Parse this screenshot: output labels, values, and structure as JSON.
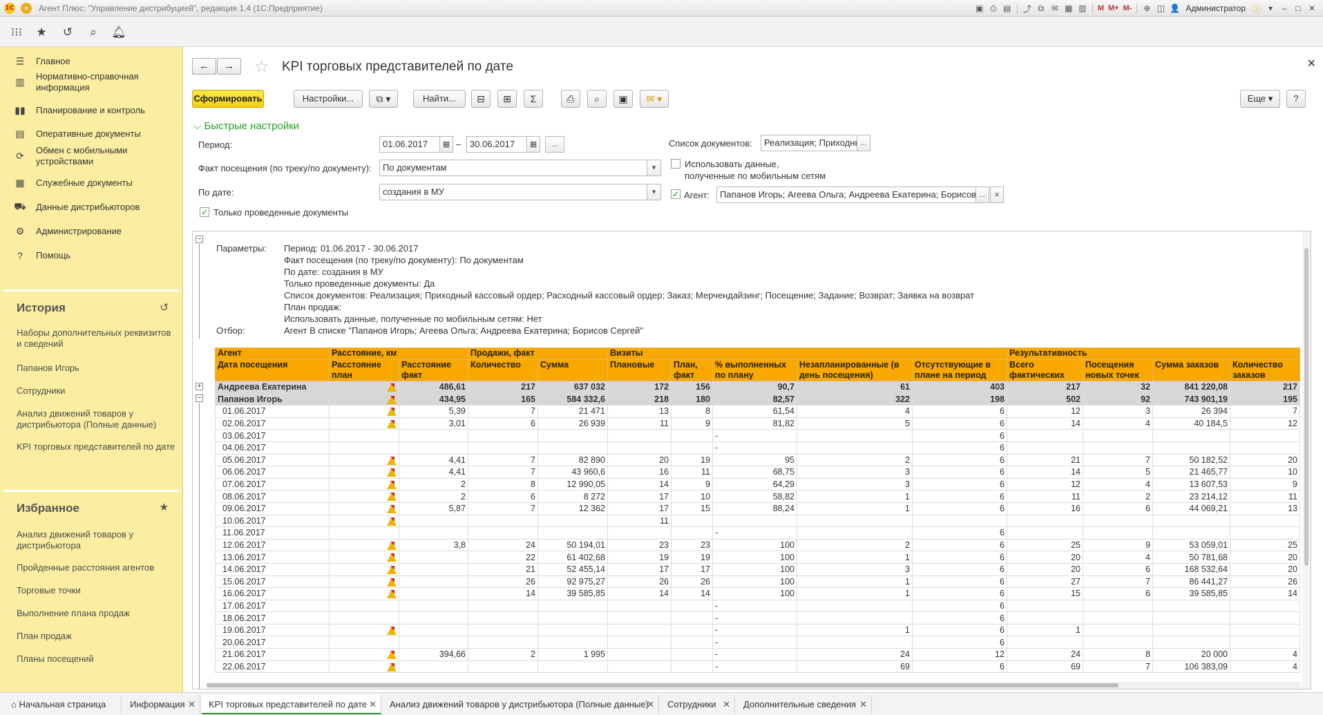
{
  "window": {
    "title": "Агент Плюс: \"Управление дистрибуцией\", редакция 1.4  (1С:Предприятие)",
    "user": "Администратор",
    "m_labels": [
      "M",
      "M+",
      "M-"
    ]
  },
  "sidebar": {
    "items": [
      {
        "icon": "menu-icon",
        "label": "Главное"
      },
      {
        "icon": "catalog-icon",
        "label": "Нормативно-справочная информация"
      },
      {
        "icon": "chart-icon",
        "label": "Планирование и контроль"
      },
      {
        "icon": "docs-icon",
        "label": "Оперативные документы"
      },
      {
        "icon": "sync-icon",
        "label": "Обмен с мобильными устройствами"
      },
      {
        "icon": "service-docs-icon",
        "label": "Служебные документы"
      },
      {
        "icon": "distributor-icon",
        "label": "Данные дистрибьюторов"
      },
      {
        "icon": "gear-icon",
        "label": "Администрирование"
      },
      {
        "icon": "help-icon",
        "label": "Помощь"
      }
    ],
    "history_title": "История",
    "history": [
      "Наборы дополнительных реквизитов и сведений",
      "Папанов Игорь",
      "Сотрудники",
      "Анализ движений товаров у дистрибьютора (Полные данные)",
      "KPI торговых представителей по дате"
    ],
    "favorites_title": "Избранное",
    "favorites": [
      "Анализ движений товаров у дистрибьютора",
      "Пройденные расстояния агентов",
      "Торговые точки",
      "Выполнение плана продаж",
      "План продаж",
      "Планы посещений"
    ]
  },
  "form": {
    "title": "KPI торговых представителей по дате",
    "generate_label": "Сформировать",
    "settings_label": "Настройки...",
    "find_label": "Найти...",
    "more_label": "Еще",
    "help_label": "?",
    "quick_settings": "Быстрые настройки",
    "period_label": "Период:",
    "period_from": "01.06.2017",
    "period_to": "30.06.2017",
    "dash": "–",
    "fact_label": "Факт посещения (по треку/по документу):",
    "fact_value": "По документам",
    "bydate_label": "По дате:",
    "bydate_value": "создания в МУ",
    "only_posted": "Только проведенные документы",
    "doclist_label": "Список документов:",
    "doclist_value": "Реализация; Приходный кассовый ордер",
    "mobile_line1": "Использовать данные,",
    "mobile_line2": "полученные по мобильным сетям",
    "agent_label": "Агент:",
    "agent_value": "Папанов Игорь; Агеева Ольга; Андреева Екатерина; Борисов Сергей",
    "ellipsis": "...",
    "clear": "×"
  },
  "report": {
    "params_label": "Параметры:",
    "params": [
      "Период: 01.06.2017 - 30.06.2017",
      "Факт посещения (по треку/по документу): По документам",
      "По дате: создания в МУ",
      "Только проведенные документы: Да",
      "Список документов: Реализация; Приходный кассовый ордер; Расходный кассовый ордер; Заказ; Мерчендайзинг; Посещение; Задание; Возврат; Заявка на возврат",
      "План продаж:",
      "Использовать данные, полученные по мобильным сетям: Нет"
    ],
    "filter_label": "Отбор:",
    "filter": "Агент В списке \"Папанов Игорь; Агеева Ольга; Андреева Екатерина; Борисов Сергей\"",
    "header_groups": [
      "Агент",
      "Расстояние, км",
      "Продажи, факт",
      "Визиты",
      "Результативность"
    ],
    "headers": [
      "Дата посещения",
      "Расстояние план",
      "Расстояние факт",
      "Количество",
      "Сумма",
      "Плановые",
      "План, факт",
      "% выполненных по плану",
      "Незапланированные (в день посещения)",
      "Отсутствующие в плане на период",
      "Всего фактических",
      "Посещения новых точек",
      "Сумма заказов",
      "Количество заказов"
    ],
    "group_rows": [
      {
        "name": "Андреева Екатерина",
        "expander": "+",
        "cells": [
          "",
          "486,61",
          "217",
          "637 032",
          "172",
          "156",
          "90,7",
          "61",
          "403",
          "217",
          "32",
          "841 220,08",
          "217"
        ]
      },
      {
        "name": "Папанов Игорь",
        "expander": "−",
        "cells": [
          "",
          "434,95",
          "165",
          "584 332,6",
          "218",
          "180",
          "82,57",
          "322",
          "198",
          "502",
          "92",
          "743 901,19",
          "195"
        ]
      }
    ],
    "rows": [
      {
        "date": "01.06.2017",
        "warn": true,
        "cells": [
          "5,39",
          "7",
          "21 471",
          "13",
          "8",
          "61,54",
          "4",
          "6",
          "12",
          "3",
          "26 394",
          "7"
        ]
      },
      {
        "date": "02.06.2017",
        "warn": true,
        "cells": [
          "3,01",
          "6",
          "26 939",
          "11",
          "9",
          "81,82",
          "5",
          "6",
          "14",
          "4",
          "40 184,5",
          "12"
        ]
      },
      {
        "date": "03.06.2017",
        "warn": false,
        "cells": [
          "",
          "",
          "",
          "",
          "",
          "-",
          "",
          "6",
          "",
          "",
          "",
          ""
        ]
      },
      {
        "date": "04.06.2017",
        "warn": false,
        "cells": [
          "",
          "",
          "",
          "",
          "",
          "-",
          "",
          "6",
          "",
          "",
          "",
          ""
        ]
      },
      {
        "date": "05.06.2017",
        "warn": true,
        "cells": [
          "4,41",
          "7",
          "82 890",
          "20",
          "19",
          "95",
          "2",
          "6",
          "21",
          "7",
          "50 182,52",
          "20"
        ]
      },
      {
        "date": "06.06.2017",
        "warn": true,
        "cells": [
          "4,41",
          "7",
          "43 960,6",
          "16",
          "11",
          "68,75",
          "3",
          "6",
          "14",
          "5",
          "21 465,77",
          "10"
        ]
      },
      {
        "date": "07.06.2017",
        "warn": true,
        "cells": [
          "2",
          "8",
          "12 990,05",
          "14",
          "9",
          "64,29",
          "3",
          "6",
          "12",
          "4",
          "13 607,53",
          "9"
        ]
      },
      {
        "date": "08.06.2017",
        "warn": true,
        "cells": [
          "2",
          "6",
          "8 272",
          "17",
          "10",
          "58,82",
          "1",
          "6",
          "11",
          "2",
          "23 214,12",
          "11"
        ]
      },
      {
        "date": "09.06.2017",
        "warn": true,
        "cells": [
          "5,87",
          "7",
          "12 362",
          "17",
          "15",
          "88,24",
          "1",
          "6",
          "16",
          "6",
          "44 069,21",
          "13"
        ]
      },
      {
        "date": "10.06.2017",
        "warn": true,
        "cells": [
          "",
          "",
          "",
          "11",
          "",
          "",
          "",
          "",
          "",
          "",
          "",
          ""
        ]
      },
      {
        "date": "11.06.2017",
        "warn": false,
        "cells": [
          "",
          "",
          "",
          "",
          "",
          "-",
          "",
          "6",
          "",
          "",
          "",
          ""
        ]
      },
      {
        "date": "12.06.2017",
        "warn": true,
        "cells": [
          "3,8",
          "24",
          "50 194,01",
          "23",
          "23",
          "100",
          "2",
          "6",
          "25",
          "9",
          "53 059,01",
          "25"
        ]
      },
      {
        "date": "13.06.2017",
        "warn": true,
        "cells": [
          "",
          "22",
          "61 402,68",
          "19",
          "19",
          "100",
          "1",
          "6",
          "20",
          "4",
          "50 781,68",
          "20"
        ]
      },
      {
        "date": "14.06.2017",
        "warn": true,
        "cells": [
          "",
          "21",
          "52 455,14",
          "17",
          "17",
          "100",
          "3",
          "6",
          "20",
          "6",
          "168 532,64",
          "20"
        ]
      },
      {
        "date": "15.06.2017",
        "warn": true,
        "cells": [
          "",
          "26",
          "92 975,27",
          "26",
          "26",
          "100",
          "1",
          "6",
          "27",
          "7",
          "86 441,27",
          "26"
        ]
      },
      {
        "date": "16.06.2017",
        "warn": true,
        "cells": [
          "",
          "14",
          "39 585,85",
          "14",
          "14",
          "100",
          "1",
          "6",
          "15",
          "6",
          "39 585,85",
          "14"
        ]
      },
      {
        "date": "17.06.2017",
        "warn": false,
        "cells": [
          "",
          "",
          "",
          "",
          "",
          "-",
          "",
          "6",
          "",
          "",
          "",
          ""
        ]
      },
      {
        "date": "18.06.2017",
        "warn": false,
        "cells": [
          "",
          "",
          "",
          "",
          "",
          "-",
          "",
          "6",
          "",
          "",
          "",
          ""
        ]
      },
      {
        "date": "19.06.2017",
        "warn": true,
        "cells": [
          "",
          "",
          "",
          "",
          "",
          "-",
          "1",
          "6",
          "1",
          "",
          "",
          ""
        ]
      },
      {
        "date": "20.06.2017",
        "warn": false,
        "cells": [
          "",
          "",
          "",
          "",
          "",
          "-",
          "",
          "6",
          "",
          "",
          "",
          ""
        ]
      },
      {
        "date": "21.06.2017",
        "warn": true,
        "cells": [
          "394,66",
          "2",
          "1 995",
          "",
          "",
          "-",
          "24",
          "12",
          "24",
          "8",
          "20 000",
          "4"
        ]
      },
      {
        "date": "22.06.2017",
        "warn": true,
        "cells": [
          "",
          "",
          "",
          "",
          "",
          "-",
          "69",
          "6",
          "69",
          "7",
          "106 383,09",
          "4"
        ]
      }
    ]
  },
  "tabs": [
    {
      "label": "Начальная страница",
      "closable": false
    },
    {
      "label": "Информация",
      "closable": true
    },
    {
      "label": "KPI торговых представителей по дате",
      "closable": true,
      "active": true
    },
    {
      "label": "Анализ движений товаров у дистрибьютора (Полные данные)",
      "closable": true
    },
    {
      "label": "Сотрудники",
      "closable": true
    },
    {
      "label": "Дополнительные сведения",
      "closable": true
    }
  ],
  "colors": {
    "accent": "#f9a701",
    "sidebar": "#fbeda1",
    "primary_button": "#f4cf10",
    "link_green": "#26a026"
  }
}
